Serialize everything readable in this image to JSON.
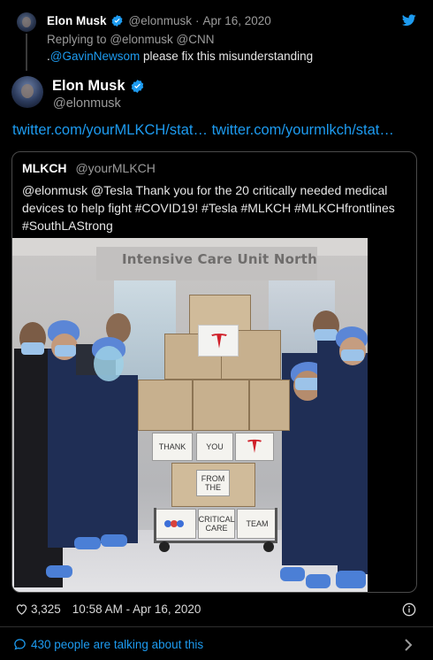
{
  "parent_tweet": {
    "name": "Elon Musk",
    "handle": "@elonmusk",
    "separator": "·",
    "date": "Apr 16, 2020",
    "replying_prefix": "Replying to",
    "replying_to": "@elonmusk @CNN",
    "text_prefix": ".",
    "text_mention": "@GavinNewsom",
    "text_rest": " please fix this misunderstanding"
  },
  "tweet": {
    "name": "Elon Musk",
    "handle": "@elonmusk",
    "link1": "twitter.com/yourMLKCH/stat…",
    "link2": "twitter.com/yourmlkch/stat…"
  },
  "quoted_tweet": {
    "name": "MLKCH",
    "handle": "@yourMLKCH",
    "text": "@elonmusk @Tesla Thank you for the 20 critically needed medical devices to help fight #COVID19! #Tesla #MLKCH #MLKCHfrontlines #SouthLAStrong",
    "photo": {
      "sign": "Intensive Care Unit North",
      "card_thank": "THANK",
      "card_you": "YOU",
      "card_from": "FROM THE",
      "card_critical": "CRITICAL CARE",
      "card_team": "TEAM"
    }
  },
  "footer": {
    "likes": "3,325",
    "time": "10:58 AM - Apr 16, 2020",
    "talking": "430 people are talking about this"
  },
  "colors": {
    "link": "#1d9bf0",
    "verified": "#1d9bf0",
    "background": "#000000"
  },
  "icons": {
    "verified": "verified-badge-icon",
    "bird": "twitter-bird-icon",
    "heart": "heart-icon",
    "info": "info-icon",
    "bubble": "speech-bubble-icon",
    "chevron": "chevron-right-icon"
  }
}
